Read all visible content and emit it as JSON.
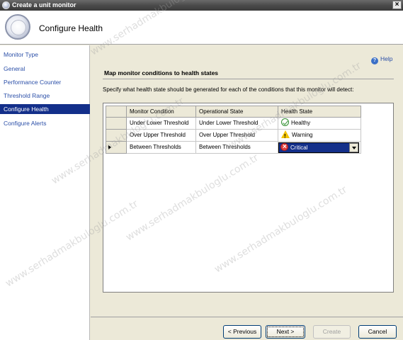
{
  "window": {
    "title": "Create a unit monitor",
    "close_glyph": "×"
  },
  "header": {
    "title": "Configure Health"
  },
  "sidebar": {
    "items": [
      {
        "label": "Monitor Type",
        "active": false
      },
      {
        "label": "General",
        "active": false
      },
      {
        "label": "Performance Counter",
        "active": false
      },
      {
        "label": "Threshold Range",
        "active": false
      },
      {
        "label": "Configure Health",
        "active": true
      },
      {
        "label": "Configure Alerts",
        "active": false
      }
    ]
  },
  "help": {
    "label": "Help"
  },
  "main": {
    "section_title": "Map monitor conditions to health states",
    "description": "Specify what health state should be generated for each of the conditions that this monitor will detect:",
    "columns": [
      "Monitor Condition",
      "Operational State",
      "Health State"
    ],
    "rows": [
      {
        "condition": "Under Lower Threshold",
        "state": "Under Lower Threshold",
        "health": "Healthy",
        "health_icon": "healthy-check-icon",
        "selected": false
      },
      {
        "condition": "Over Upper Threshold",
        "state": "Over Upper Threshold",
        "health": "Warning",
        "health_icon": "warning-triangle-icon",
        "selected": false
      },
      {
        "condition": "Between Thresholds",
        "state": "Between Thresholds",
        "health": "Critical",
        "health_icon": "critical-x-icon",
        "selected": true
      }
    ]
  },
  "footer": {
    "previous": "< Previous",
    "next": "Next >",
    "create": "Create",
    "cancel": "Cancel"
  },
  "watermark": {
    "text": "www.serhadmakbuloglu.com.tr"
  },
  "colors": {
    "selection": "#132f8a",
    "link": "#2b4fa8",
    "critical": "#e04040",
    "warning": "#f2c200",
    "healthy": "#2f8f2f"
  }
}
